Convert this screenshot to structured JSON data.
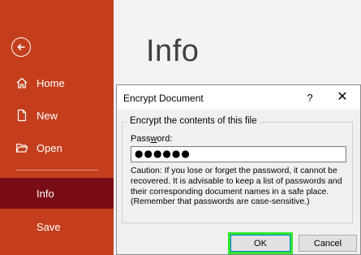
{
  "sidebar": {
    "items": [
      {
        "label": "Home"
      },
      {
        "label": "New"
      },
      {
        "label": "Open"
      },
      {
        "label": "Info"
      },
      {
        "label": "Save"
      }
    ]
  },
  "main": {
    "title": "Info"
  },
  "dialog": {
    "title": "Encrypt Document",
    "help": "?",
    "close": "✕",
    "group_label": "Encrypt the contents of this file",
    "password_label_prefix": "Pass",
    "password_label_underlined": "w",
    "password_label_suffix": "ord:",
    "password_value": "●●●●●●",
    "caution_text": "Caution: If you lose or forget the password, it cannot be recovered. It is advisable to keep a list of passwords and their corresponding document names in a safe place.",
    "reminder_text": "(Remember that passwords are case-sensitive.)",
    "ok_label": "OK",
    "cancel_label": "Cancel"
  },
  "colors": {
    "sidebar_bg": "#c43e1c",
    "sidebar_active_bg": "#7a0c16",
    "ok_highlight": "#2ee82e"
  }
}
